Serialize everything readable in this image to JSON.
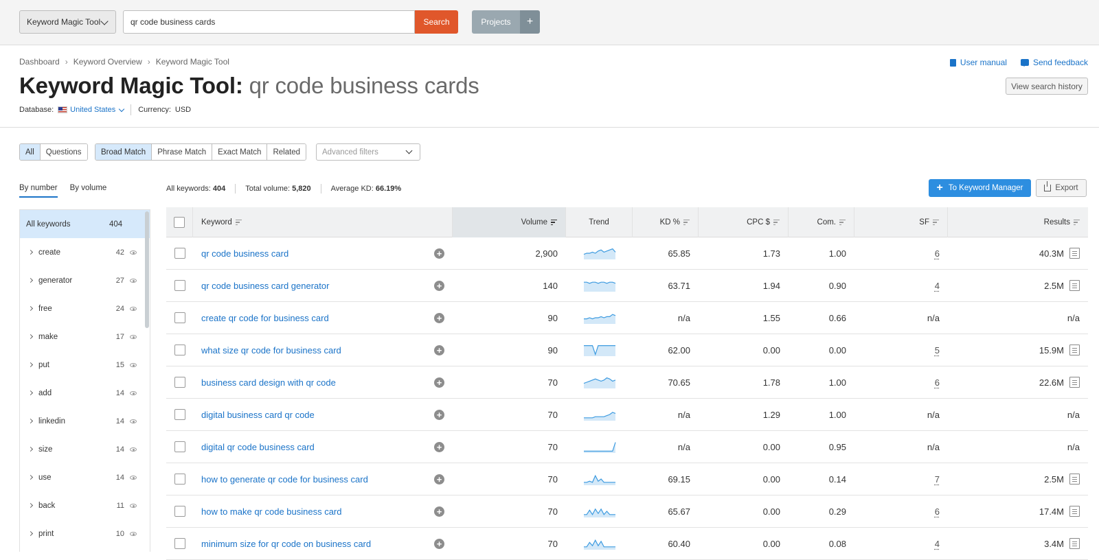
{
  "topbar": {
    "tool_select": "Keyword Magic Tool",
    "search_value": "qr code business cards",
    "search_label": "Search",
    "projects_label": "Projects",
    "projects_plus": "+"
  },
  "breadcrumb": [
    "Dashboard",
    "Keyword Overview",
    "Keyword Magic Tool"
  ],
  "links": {
    "user_manual": "User manual",
    "send_feedback": "Send feedback"
  },
  "title": {
    "prefix": "Keyword Magic Tool:",
    "query": "qr code business cards"
  },
  "view_history": "View search history",
  "database": {
    "label": "Database:",
    "value": "United States",
    "currency_label": "Currency:",
    "currency": "USD"
  },
  "filters": {
    "scope": [
      "All",
      "Questions"
    ],
    "match": [
      "Broad Match",
      "Phrase Match",
      "Exact Match",
      "Related"
    ],
    "advanced": "Advanced filters"
  },
  "side_tabs": [
    "By number",
    "By volume"
  ],
  "stats": {
    "all_keywords_label": "All keywords:",
    "all_keywords": "404",
    "total_volume_label": "Total volume:",
    "total_volume": "5,820",
    "avg_kd_label": "Average KD:",
    "avg_kd": "66.19%"
  },
  "to_keyword_manager": "To Keyword Manager",
  "export": "Export",
  "sidebar": {
    "all_label": "All keywords",
    "all_count": "404",
    "items": [
      {
        "label": "create",
        "count": "42"
      },
      {
        "label": "generator",
        "count": "27"
      },
      {
        "label": "free",
        "count": "24"
      },
      {
        "label": "make",
        "count": "17"
      },
      {
        "label": "put",
        "count": "15"
      },
      {
        "label": "add",
        "count": "14"
      },
      {
        "label": "linkedin",
        "count": "14"
      },
      {
        "label": "size",
        "count": "14"
      },
      {
        "label": "use",
        "count": "14"
      },
      {
        "label": "back",
        "count": "11"
      },
      {
        "label": "print",
        "count": "10"
      }
    ]
  },
  "table": {
    "headers": [
      "Keyword",
      "Volume",
      "Trend",
      "KD %",
      "CPC $",
      "Com.",
      "SF",
      "Results"
    ],
    "rows": [
      {
        "keyword": "qr code business card",
        "volume": "2,900",
        "kd": "65.85",
        "cpc": "1.73",
        "com": "1.00",
        "sf": "6",
        "results": "40.3M",
        "trend": [
          4,
          5,
          5,
          6,
          5,
          7,
          8,
          6,
          7,
          8,
          9,
          6
        ]
      },
      {
        "keyword": "qr code business card generator",
        "volume": "140",
        "kd": "63.71",
        "cpc": "1.94",
        "com": "0.90",
        "sf": "4",
        "results": "2.5M",
        "trend": [
          8,
          8,
          7,
          8,
          8,
          7,
          8,
          8,
          7,
          8,
          8,
          7
        ]
      },
      {
        "keyword": "create qr code for business card",
        "volume": "90",
        "kd": "n/a",
        "cpc": "1.55",
        "com": "0.66",
        "sf": "n/a",
        "results": "n/a",
        "trend": [
          4,
          4,
          5,
          4,
          5,
          5,
          6,
          5,
          6,
          6,
          8,
          7
        ]
      },
      {
        "keyword": "what size qr code for business card",
        "volume": "90",
        "kd": "62.00",
        "cpc": "0.00",
        "com": "0.00",
        "sf": "5",
        "results": "15.9M",
        "trend": [
          9,
          9,
          9,
          9,
          1,
          9,
          9,
          9,
          9,
          9,
          9,
          9
        ]
      },
      {
        "keyword": "business card design with qr code",
        "volume": "70",
        "kd": "70.65",
        "cpc": "1.78",
        "com": "1.00",
        "sf": "6",
        "results": "22.6M",
        "trend": [
          4,
          5,
          6,
          7,
          8,
          7,
          6,
          7,
          9,
          8,
          6,
          7
        ]
      },
      {
        "keyword": "digital business card qr code",
        "volume": "70",
        "kd": "n/a",
        "cpc": "1.29",
        "com": "1.00",
        "sf": "n/a",
        "results": "n/a",
        "trend": [
          2,
          2,
          2,
          2,
          3,
          3,
          3,
          3,
          4,
          5,
          7,
          6
        ]
      },
      {
        "keyword": "digital qr code business card",
        "volume": "70",
        "kd": "n/a",
        "cpc": "0.00",
        "com": "0.95",
        "sf": "n/a",
        "results": "n/a",
        "trend": [
          1,
          1,
          1,
          1,
          1,
          1,
          1,
          1,
          1,
          1,
          1,
          9
        ]
      },
      {
        "keyword": "how to generate qr code for business card",
        "volume": "70",
        "kd": "69.15",
        "cpc": "0.00",
        "com": "0.14",
        "sf": "7",
        "results": "2.5M",
        "trend": [
          2,
          2,
          3,
          2,
          8,
          3,
          5,
          2,
          2,
          2,
          2,
          2
        ]
      },
      {
        "keyword": "how to make qr code business card",
        "volume": "70",
        "kd": "65.67",
        "cpc": "0.00",
        "com": "0.29",
        "sf": "6",
        "results": "17.4M",
        "trend": [
          2,
          2,
          6,
          2,
          7,
          3,
          7,
          2,
          5,
          2,
          2,
          2
        ]
      },
      {
        "keyword": "minimum size for qr code on business card",
        "volume": "70",
        "kd": "60.40",
        "cpc": "0.00",
        "com": "0.08",
        "sf": "4",
        "results": "3.4M",
        "trend": [
          2,
          2,
          6,
          3,
          8,
          3,
          7,
          2,
          2,
          2,
          2,
          2
        ]
      }
    ]
  }
}
